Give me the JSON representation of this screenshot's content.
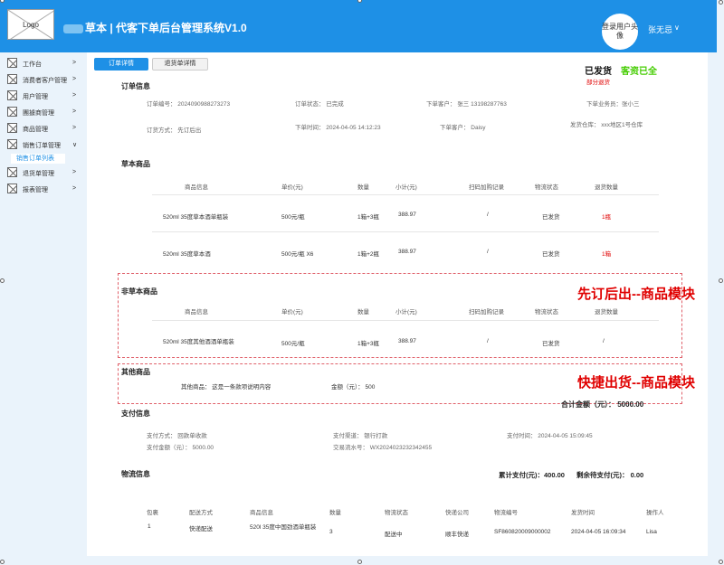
{
  "header": {
    "logo": "Logo",
    "title_suffix": "草本 | 代客下单后台管理系统V1.0",
    "avatar_text": "登录用户头像",
    "username": "张无忌",
    "chevron": "∨"
  },
  "sidebar": {
    "items": [
      {
        "label": "工作台",
        "arrow": ">"
      },
      {
        "label": "消费者客户管理",
        "arrow": ">"
      },
      {
        "label": "用户管理",
        "arrow": ">"
      },
      {
        "label": "團據商管理",
        "arrow": ">"
      },
      {
        "label": "商品管理",
        "arrow": ">"
      },
      {
        "label": "销售订单管理",
        "arrow": "∨"
      },
      {
        "label": "退货单管理",
        "arrow": ">"
      },
      {
        "label": "报表管理",
        "arrow": ">"
      }
    ],
    "sub": "销售订单列表"
  },
  "tabs": {
    "t1": "订单详情",
    "t2": "退货单详情"
  },
  "status": {
    "shipped": "已发货",
    "paid": "客资已全",
    "partial": "部分退货"
  },
  "order": {
    "title": "订单信息",
    "no": "订单编号： 2024090988273273",
    "state": "订单状态： 已完成",
    "cust": "下单客户： 张三   13198287763",
    "sales": "下单业务员：张小三",
    "mode": "订货方式：  先订后出",
    "time": "下单时间： 2024-04-05 14:12:23",
    "cust2": "下单客户： Daisy",
    "wh": "发货仓库： xxx地区1号仓库"
  },
  "herbal": {
    "title": "草本商品",
    "headers": [
      "商品信息",
      "单价(元)",
      "数量",
      "小计(元)",
      "扫码加购记录",
      "物流状态",
      "退货数量"
    ],
    "rows": [
      [
        "520ml 35度草本酒单瓶装",
        "500元/瓶",
        "1箱+3瓶",
        "388.97",
        "/",
        "已发货",
        "1瓶"
      ],
      [
        "520ml 35度草本酒",
        "500元/瓶   X6",
        "1箱+2瓶",
        "388.97",
        "/",
        "已发货",
        "1箱"
      ]
    ]
  },
  "nonherbal": {
    "title": "非草本商品",
    "headers": [
      "商品信息",
      "单价(元)",
      "数量",
      "小计(元)",
      "扫码加购记录",
      "物流状态",
      "退货数量"
    ],
    "rows": [
      [
        "520ml 35度其他酒酒单瓶装",
        "500元/瓶",
        "1箱+3瓶",
        "388.97",
        "/",
        "已发货",
        "/"
      ]
    ]
  },
  "notes": {
    "n1": "先订后出--商品模块",
    "n2": "快捷出货--商品模块"
  },
  "other": {
    "title": "其他商品",
    "desc": "其他商品： 这是一条款项说明内容",
    "amt": "金额（元）： 500",
    "total": "合计金额（元）： 5000.00"
  },
  "pay": {
    "title": "支付信息",
    "method": "支付方式： 回款单收款",
    "channel": "支付渠道： 银行打款",
    "time": "支付时间：  2024-04-05 15:09:45",
    "amount": "支付金额（元）： 5000.00",
    "serial": "交易流水号： WX2024023232342455"
  },
  "logi": {
    "title": "物流信息",
    "paid": "累计支付(元)：400.00",
    "remain": "剩余待支付(元)： 0.00",
    "headers": [
      "包裹",
      "配送方式",
      "商品信息",
      "数量",
      "物流状态",
      "快递公司",
      "物流编号",
      "发货时间",
      "操作人"
    ],
    "row": [
      "1",
      "快递配送",
      "520l 35度中国劲酒单瓶装",
      "3",
      "配送中",
      "顺丰快递",
      "SF860820009000002",
      "2024-04-05 16:09:34",
      "Lisa"
    ]
  }
}
